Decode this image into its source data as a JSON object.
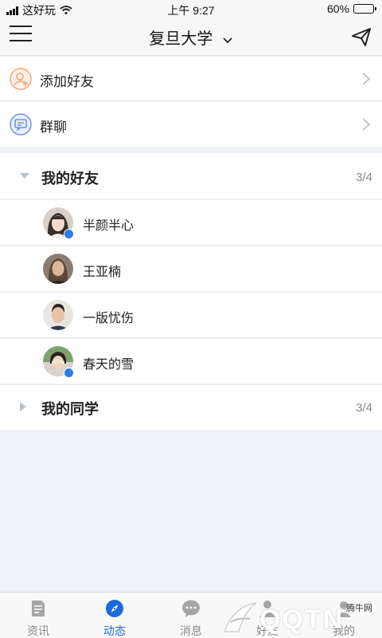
{
  "status_bar": {
    "carrier": "这好玩",
    "time": "上午 9:27",
    "battery": "60%",
    "battery_level": 0.6
  },
  "navbar": {
    "title": "复旦大学"
  },
  "actions": [
    {
      "label": "添加好友",
      "icon": "add-user-icon",
      "color": "#f0a676"
    },
    {
      "label": "群聊",
      "icon": "group-chat-icon",
      "color": "#6f93d8"
    }
  ],
  "groups": [
    {
      "title": "我的好友",
      "count": "3/4",
      "expanded": true
    },
    {
      "title": "我的同学",
      "count": "3/4",
      "expanded": false
    }
  ],
  "friends": [
    {
      "name": "半颜半心",
      "verified": true
    },
    {
      "name": "王亚楠",
      "verified": false
    },
    {
      "name": "一版忧伤",
      "verified": false
    },
    {
      "name": "春天的雪",
      "verified": true
    }
  ],
  "tabs": [
    {
      "label": "资讯",
      "icon": "news-icon",
      "active": false
    },
    {
      "label": "动态",
      "icon": "compass-icon",
      "active": true
    },
    {
      "label": "消息",
      "icon": "message-icon",
      "active": false
    },
    {
      "label": "好友",
      "icon": "friends-icon",
      "active": false
    },
    {
      "label": "我的",
      "icon": "profile-icon",
      "active": false
    }
  ],
  "watermark": {
    "text": "QQTN",
    "site": "腾牛网"
  },
  "colors": {
    "accent": "#1a6bd8",
    "background": "#eef2f6",
    "verified": "#2f7bea"
  }
}
